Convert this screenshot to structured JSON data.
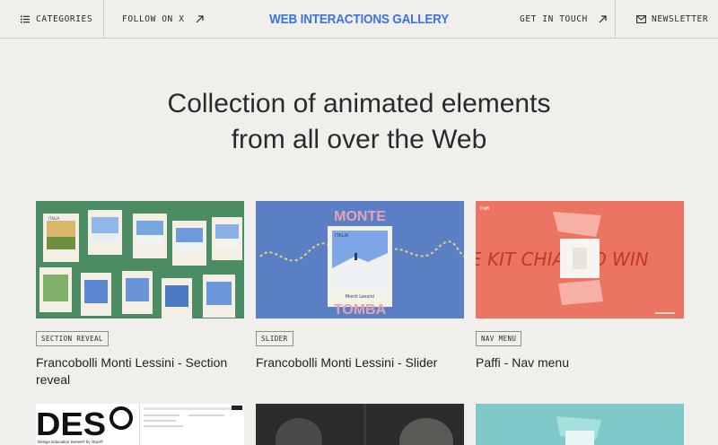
{
  "header": {
    "categories_label": "CATEGORIES",
    "follow_label": "FOLLOW ON X",
    "brand": "WEB INTERACTIONS GALLERY",
    "contact_label": "GET IN TOUCH",
    "newsletter_label": "NEWSLETTER"
  },
  "hero": {
    "line1": "Collection of animated elements",
    "line2": "from all over the Web"
  },
  "cards": [
    {
      "tag": "SECTION REVEAL",
      "title": "Francobolli Monti Lessini - Section reveal",
      "stamp_text": "ITALIA"
    },
    {
      "tag": "SLIDER",
      "title": "Francobolli Monti Lessini - Slider",
      "word_top": "MONTE",
      "word_bottom": "TOMBA",
      "stamp_country": "ITALIA",
      "stamp_name": "Monti Lessini"
    },
    {
      "tag": "NAV MENU",
      "title": "Paffi - Nav menu",
      "brand": "Paffi",
      "marquee": "E KIT CHIA   TTO WIN"
    }
  ],
  "row2": {
    "des_logo": "DES",
    "des_caption": "Design Education Series® by Otoo®"
  },
  "colors": {
    "brand": "#3a73e8",
    "background": "#f0efeb",
    "card1_bg": "#4c8c64",
    "card2_bg": "#5b7fc4",
    "card3_bg": "#ec7463"
  }
}
